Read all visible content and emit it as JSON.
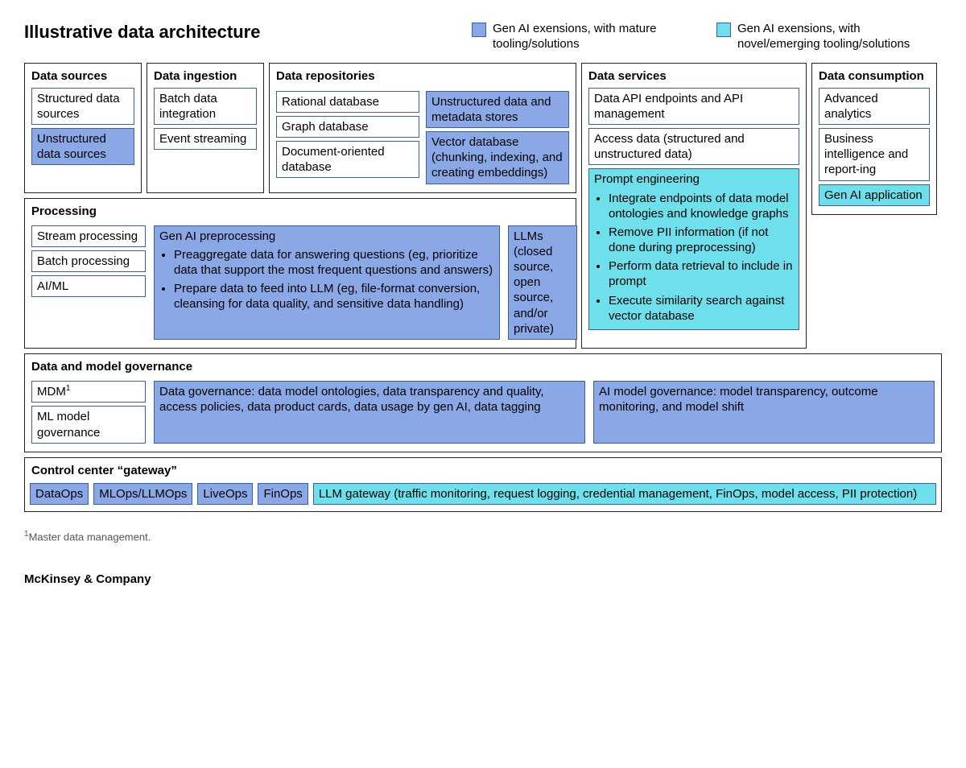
{
  "title": "Illustrative data architecture",
  "legend": {
    "mature": "Gen AI exensions, with mature tooling/solutions",
    "novel": "Gen AI exensions, with novel/emerging tooling/solutions"
  },
  "sections": {
    "data_sources": {
      "title": "Data sources",
      "items": [
        "Structured data sources",
        "Unstructured data sources"
      ]
    },
    "data_ingestion": {
      "title": "Data ingestion",
      "items": [
        "Batch data integration",
        "Event streaming"
      ]
    },
    "data_repositories": {
      "title": "Data repositories",
      "left": [
        "Rational database",
        "Graph database",
        "Document-oriented database"
      ],
      "right": [
        "Unstructured data and metadata stores",
        "Vector database (chunking, indexing, and creating embeddings)"
      ]
    },
    "processing": {
      "title": "Processing",
      "left": [
        "Stream processing",
        "Batch processing",
        "AI/ML"
      ],
      "preprocessing_title": "Gen AI preprocessing",
      "preprocessing_bullets": [
        "Preaggregate data for answering questions (eg, prioritize data that support the most frequent questions and answers)",
        "Prepare data to feed into LLM (eg, file-format conversion, cleansing for data quality, and sensitive data handling)"
      ],
      "llms": "LLMs (closed source, open source, and/or private)"
    },
    "data_services": {
      "title": "Data services",
      "items": [
        "Data API endpoints and API management",
        "Access data (structured and unstructured data)"
      ],
      "prompt_title": "Prompt engineering",
      "prompt_bullets": [
        "Integrate endpoints of data model ontologies and knowledge graphs",
        "Remove PII information (if not done during preprocessing)",
        "Perform data retrieval to include in prompt",
        "Execute similarity search against vector database"
      ]
    },
    "data_consumption": {
      "title": "Data consumption",
      "items": [
        "Advanced analytics",
        "Business intelligence and report-ing",
        "Gen AI application"
      ]
    },
    "governance": {
      "title": "Data and model governance",
      "left": [
        "MDM",
        "ML model governance"
      ],
      "data_gov": "Data governance: data model ontologies, data transparency and quality, access policies, data product cards, data usage by gen AI, data tagging",
      "ai_gov": "AI model governance: model transparency, outcome monitoring, and model shift"
    },
    "gateway": {
      "title": "Control center “gateway”",
      "ops": [
        "DataOps",
        "MLOps/LLMOps",
        "LiveOps",
        "FinOps"
      ],
      "llm_gateway": "LLM gateway (traffic monitoring, request logging, credential management, FinOps, model access, PII protection)"
    }
  },
  "footnote_marker": "1",
  "footnote": "Master data management.",
  "brand": "McKinsey & Company"
}
